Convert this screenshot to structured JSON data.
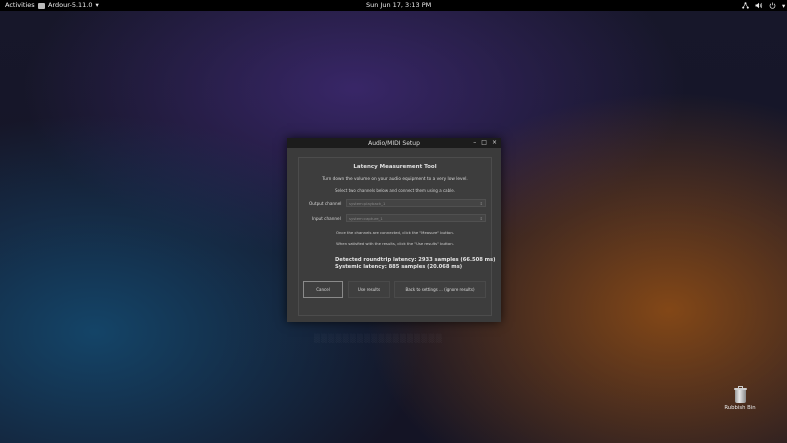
{
  "topbar": {
    "activities": "Activities",
    "app_menu": "Ardour-5.11.0",
    "app_menu_arrow": "▾",
    "clock": "Sun Jun 17,   3:13 PM",
    "tray": {
      "network_icon": "network-icon",
      "volume_icon": "volume-icon",
      "power_icon": "power-icon",
      "menu_arrow": "▾"
    }
  },
  "dialog": {
    "title": "Audio/MIDI Setup",
    "controls": {
      "minimize": "–",
      "maximize": "□",
      "close": "×"
    },
    "heading": "Latency Measurement Tool",
    "instruction1": "Turn down the volume on your audio equipment to a very low level.",
    "instruction2": "Select two channels below and connect them using a cable.",
    "output_label": "Output channel",
    "output_value": "system:playback_1",
    "input_label": "Input channel",
    "input_value": "system:capture_1",
    "note1": "Once the channels are connected, click the \"Measure\" button.",
    "note2": "When satisfied with the results, click the \"Use results\" button.",
    "result1": "Detected roundtrip latency: 2933 samples (66.508 ms)",
    "result2": "Systemic latency: 885 samples (20.068 ms)",
    "buttons": {
      "cancel": "Cancel",
      "use_results": "Use results",
      "back": "Back to settings ... (ignore results)"
    }
  },
  "desktop": {
    "rubbish_bin_label": "Rubbish Bin"
  },
  "colors": {
    "topbar_bg": "#000000",
    "dialog_bg": "#3b3b3b",
    "titlebar_bg": "#1c1c1c"
  }
}
